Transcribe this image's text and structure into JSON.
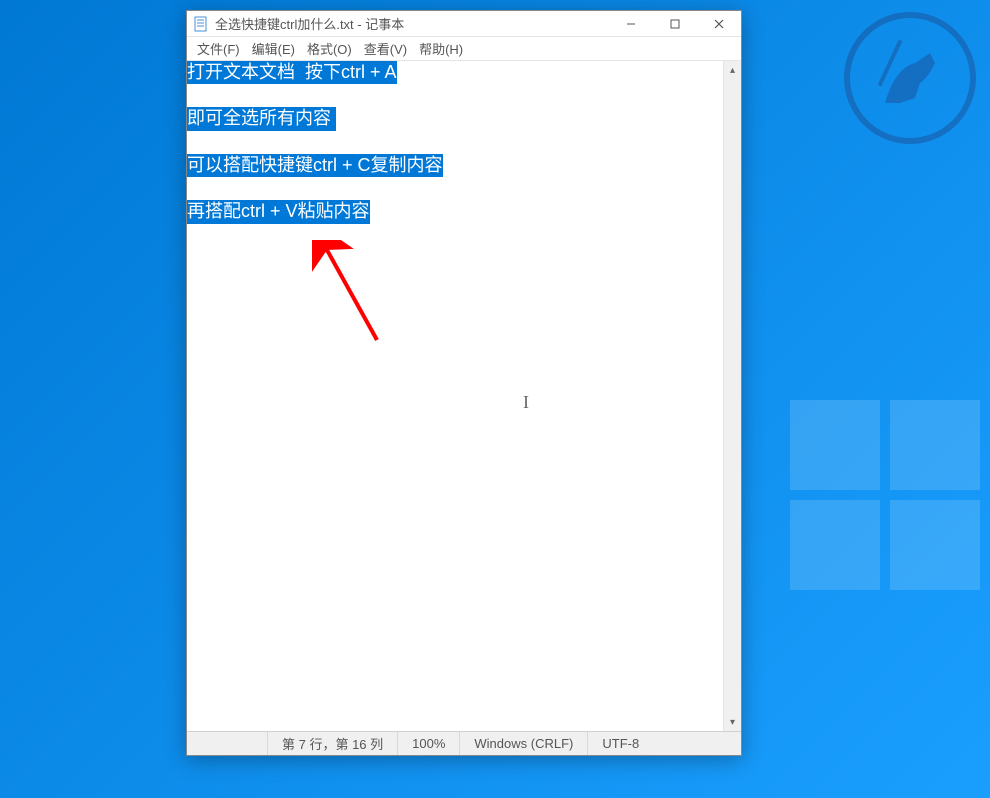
{
  "window": {
    "title": "全选快捷键ctrl加什么.txt - 记事本",
    "app_icon": "notepad-icon"
  },
  "titlebar_controls": {
    "minimize": "—",
    "maximize": "☐",
    "close": "✕"
  },
  "menubar": {
    "file": "文件(F)",
    "edit": "编辑(E)",
    "format": "格式(O)",
    "view": "查看(V)",
    "help": "帮助(H)"
  },
  "editor": {
    "lines": [
      "打开文本文档  按下ctrl + A",
      "",
      "即可全选所有内容 ",
      "",
      "可以搭配快捷键ctrl + C复制内容",
      "",
      "再搭配ctrl + V粘贴内容"
    ],
    "selection_all": true
  },
  "statusbar": {
    "position": "第 7 行，第 16 列",
    "zoom": "100%",
    "line_ending": "Windows (CRLF)",
    "encoding": "UTF-8"
  },
  "scroll": {
    "up_arrow": "▴",
    "down_arrow": "▾"
  }
}
